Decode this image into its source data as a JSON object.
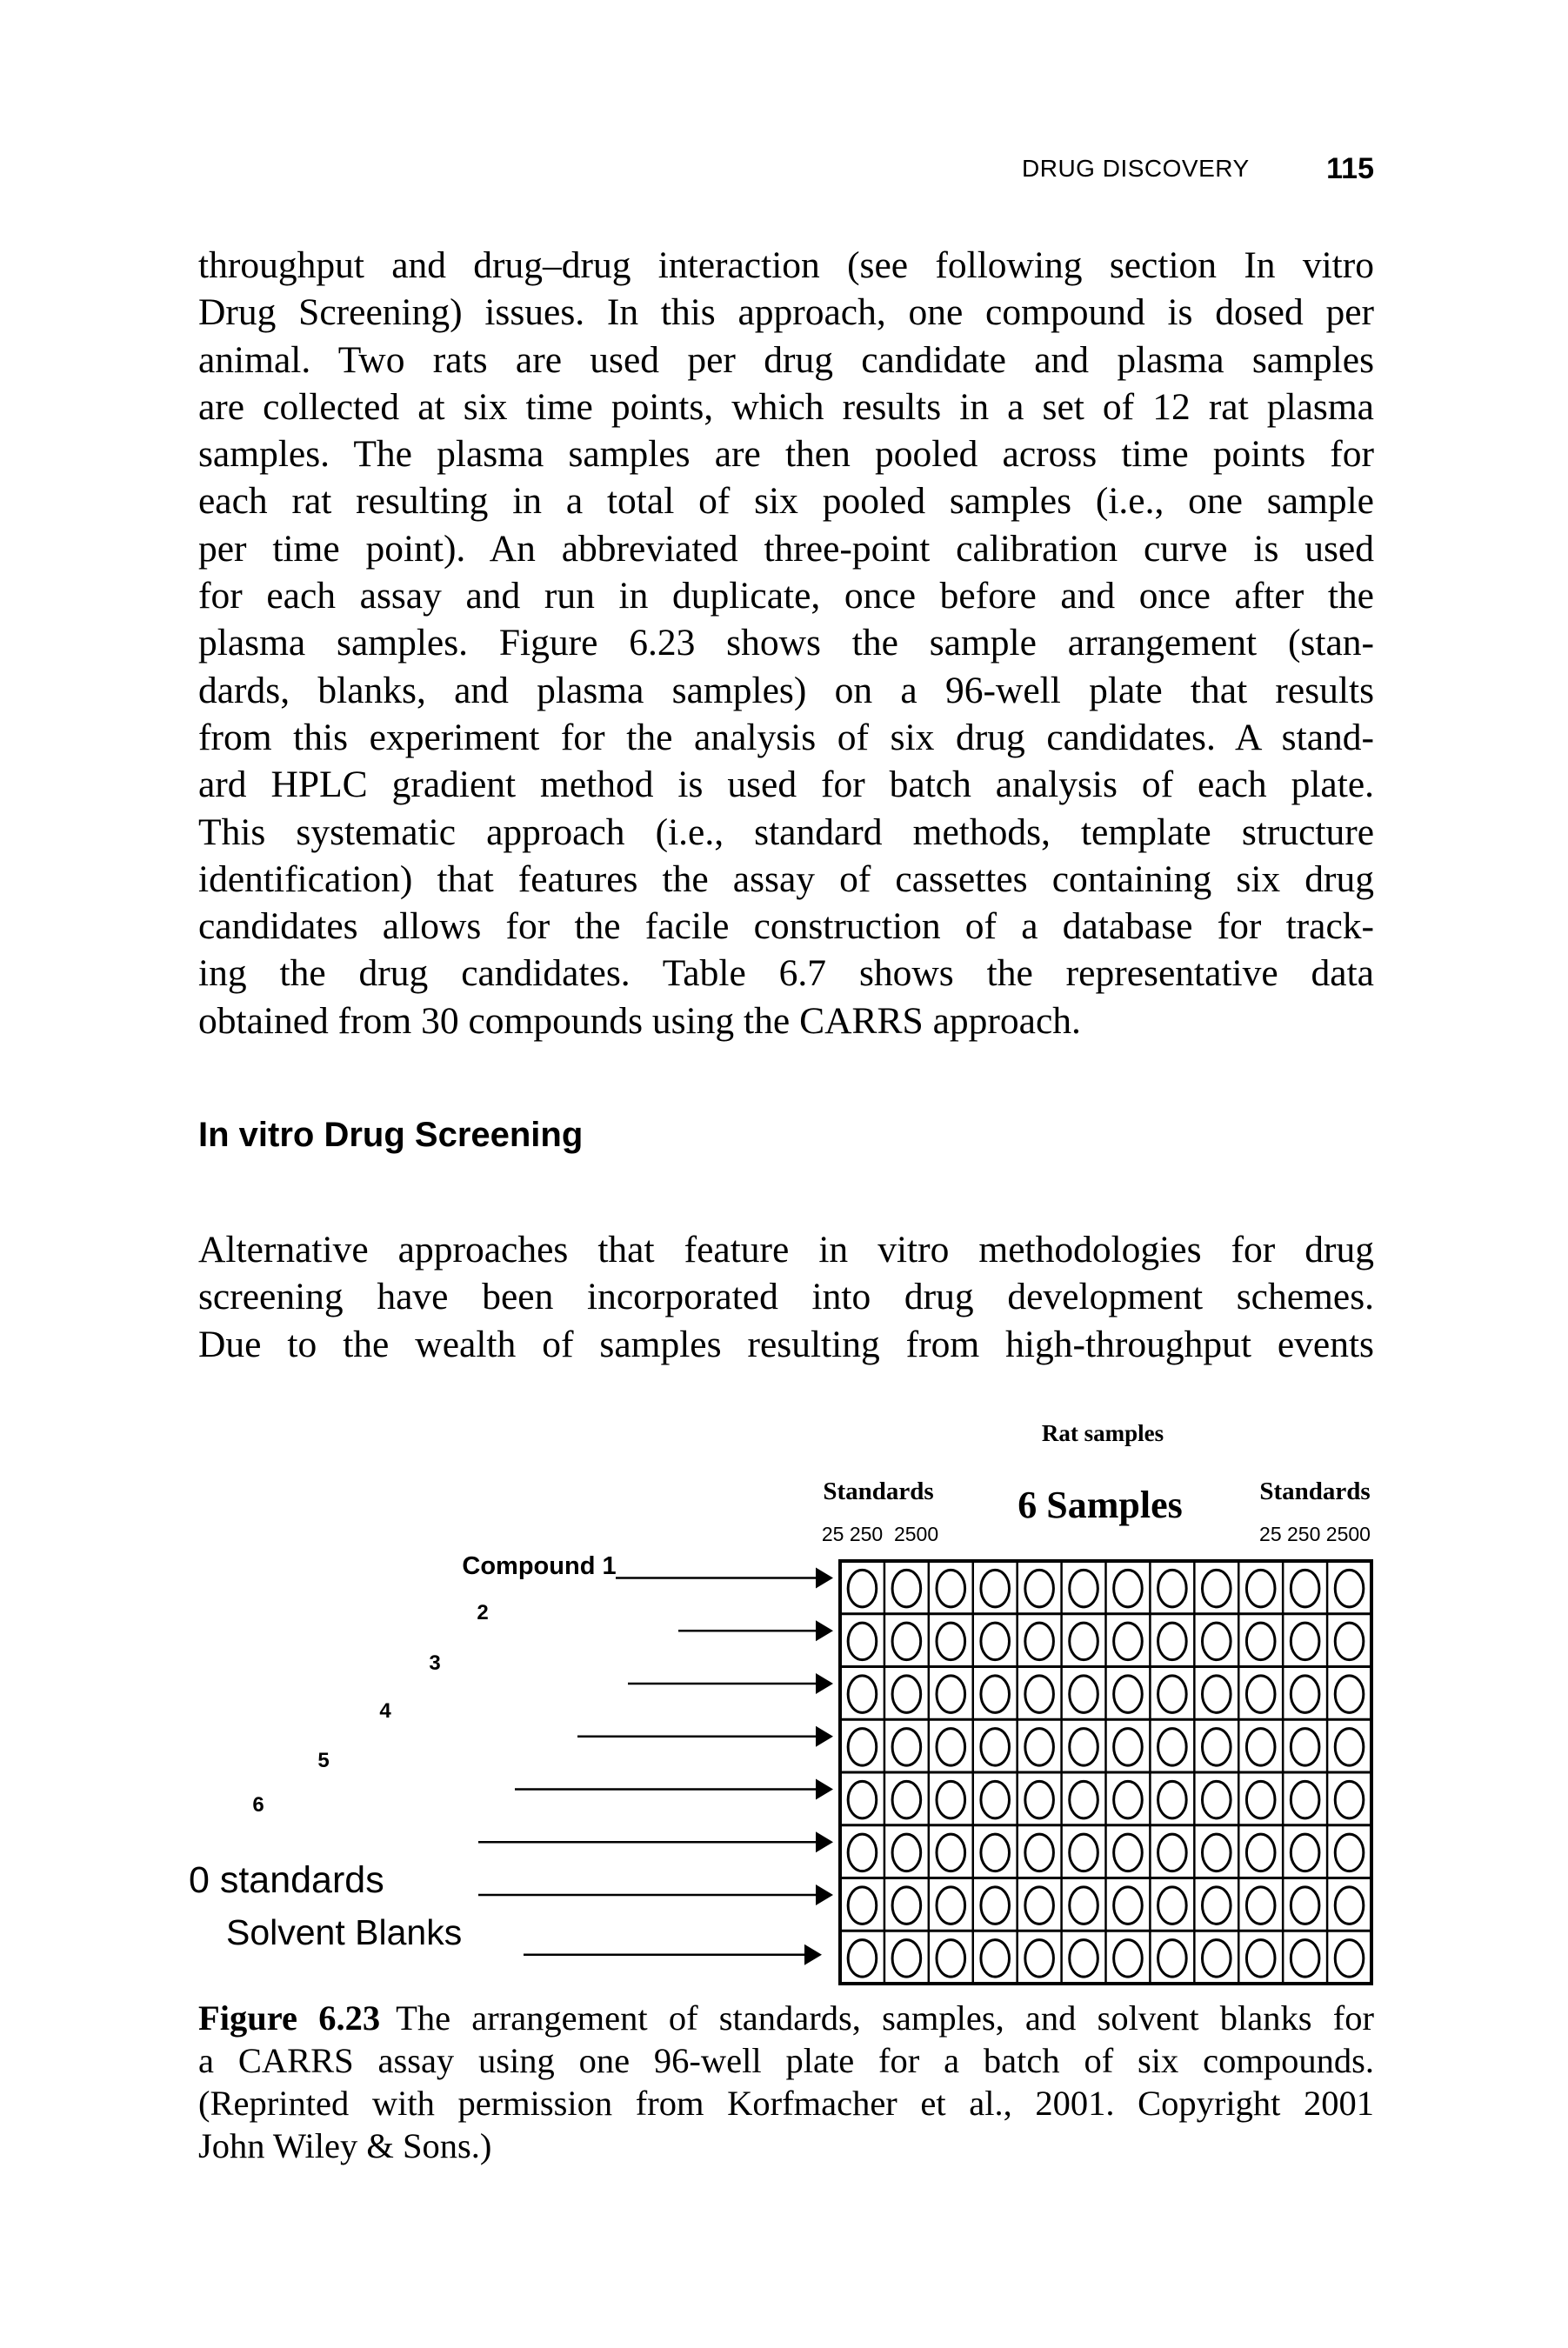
{
  "running_head": {
    "title": "DRUG DISCOVERY",
    "page_number": "115"
  },
  "paragraph_1": [
    "throughput and drug–drug interaction (see following section In vitro",
    "Drug Screening) issues. In this approach, one compound is dosed per",
    "animal. Two rats are used per drug candidate and plasma samples",
    "are collected at six time points, which results in a set of 12 rat plasma",
    "samples. The plasma samples are then pooled across time points for",
    "each rat resulting in a total of six pooled samples (i.e., one sample",
    "per time point). An abbreviated three-point calibration curve is used",
    "for each assay and run in duplicate, once before and once after the",
    "plasma samples. Figure 6.23 shows the sample arrangement (stan-",
    "dards, blanks, and plasma samples) on a 96-well plate that results",
    "from this experiment for the analysis of six drug candidates. A stand-",
    "ard HPLC gradient method is used for batch analysis of each plate.",
    "This systematic approach (i.e., standard methods, template structure",
    "identification) that features the assay of cassettes containing six drug",
    "candidates allows for the facile construction of a database for track-",
    "ing the drug candidates. Table 6.7 shows the representative data",
    "obtained from 30 compounds using the CARRS approach."
  ],
  "section_heading": "In vitro Drug Screening",
  "paragraph_2": [
    "Alternative approaches that feature in vitro methodologies for drug",
    "screening have been incorporated into drug development schemes.",
    "Due to the wealth of samples resulting from high-throughput events"
  ],
  "figure": {
    "top_label": "Rat samples",
    "left_group_label": "Standards",
    "left_group_concentrations": "25 250  2500",
    "center_label": "6 Samples",
    "right_group_label": "Standards",
    "right_group_concentrations": "25 250 2500",
    "plate": {
      "rows": 8,
      "columns": 12,
      "wells": 96
    },
    "row_labels": [
      "Compound 1",
      "2",
      "3",
      "4",
      "5",
      "6",
      "0 standards",
      "Solvent Blanks"
    ]
  },
  "caption": {
    "label": "Figure 6.23",
    "lines": [
      "The arrangement of standards, samples, and solvent blanks for",
      "a CARRS assay using one 96-well plate for a batch of six compounds.",
      "(Reprinted with permission from Korfmacher et al., 2001. Copyright 2001",
      "John Wiley & Sons.)"
    ]
  }
}
